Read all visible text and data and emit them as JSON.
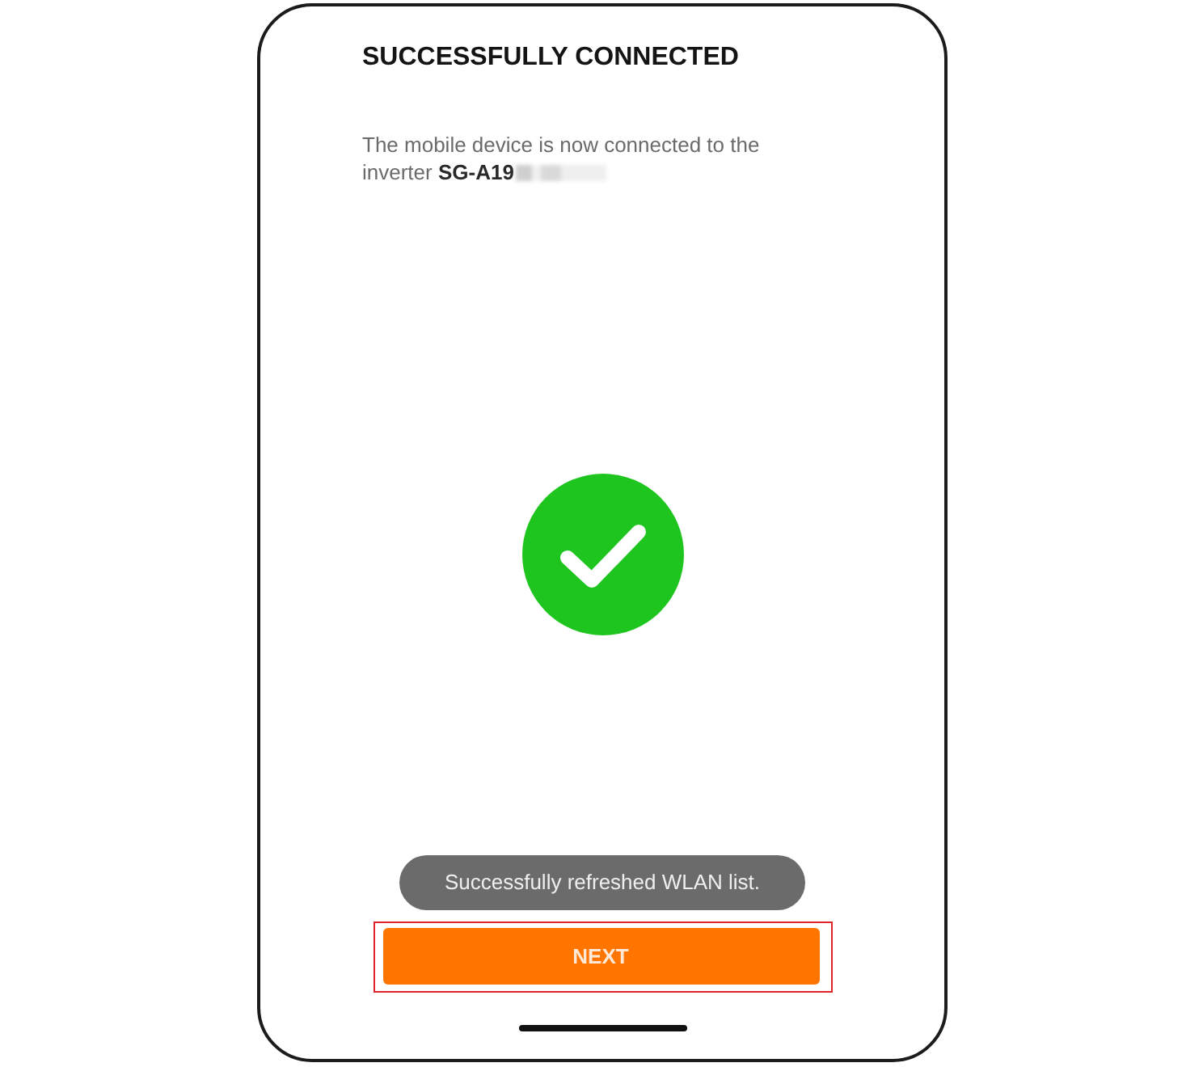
{
  "screen": {
    "title": "SUCCESSFULLY CONNECTED",
    "message": "The mobile device is now connected to the inverter **SG-A19**",
    "redacted": true
  },
  "status_icon": {
    "kind": "success"
  },
  "toast": {
    "text": "Successfully refreshed WLAN list."
  },
  "next_button": {
    "label": "NEXT",
    "highlighted": true
  }
}
